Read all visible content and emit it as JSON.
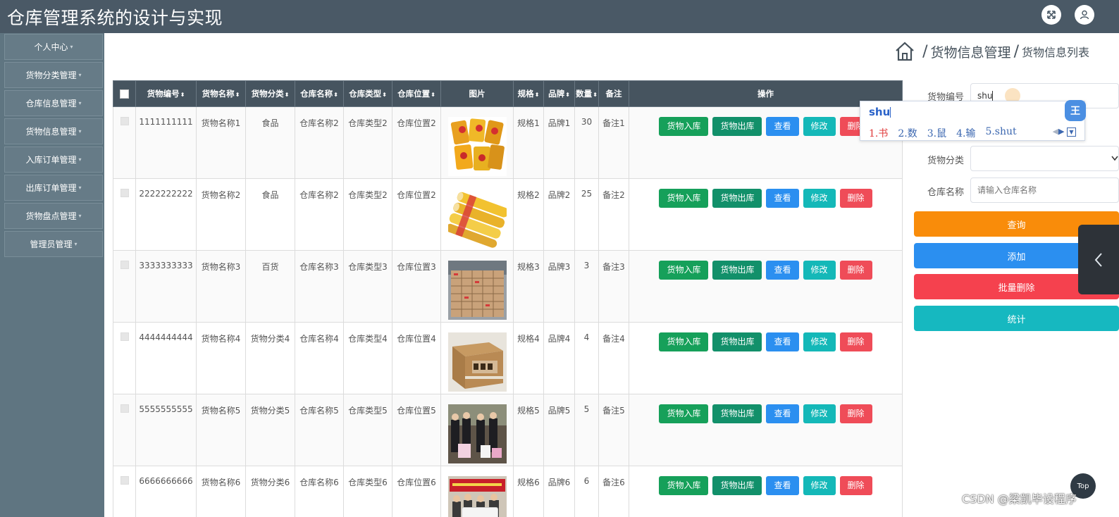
{
  "app": {
    "title": "仓库管理系统的设计与实现"
  },
  "header": {
    "fullscreen_icon": "fullscreen-icon",
    "user_icon": "user-icon"
  },
  "sidebar": {
    "items": [
      {
        "label": "个人中心"
      },
      {
        "label": "货物分类管理"
      },
      {
        "label": "仓库信息管理"
      },
      {
        "label": "货物信息管理"
      },
      {
        "label": "入库订单管理"
      },
      {
        "label": "出库订单管理"
      },
      {
        "label": "货物盘点管理"
      },
      {
        "label": "管理员管理"
      }
    ],
    "caret": "▾"
  },
  "breadcrumb": {
    "separator": "/",
    "main": "货物信息管理",
    "sub": "货物信息列表"
  },
  "table": {
    "columns": [
      "货物编号",
      "货物名称",
      "货物分类",
      "仓库名称",
      "仓库类型",
      "仓库位置",
      "图片",
      "规格",
      "品牌",
      "数量",
      "备注",
      "操作"
    ],
    "sort_glyph": "⬍",
    "rows": [
      {
        "code": "1111111111",
        "name": "货物名称1",
        "category": "食品",
        "warehouse": "仓库名称2",
        "wtype": "仓库类型2",
        "location": "仓库位置2",
        "image": "snack-bags",
        "spec": "规格1",
        "brand": "品牌1",
        "qty": "30",
        "note": "备注1"
      },
      {
        "code": "2222222222",
        "name": "货物名称2",
        "category": "食品",
        "warehouse": "仓库名称2",
        "wtype": "仓库类型2",
        "location": "仓库位置2",
        "image": "chip-cans",
        "spec": "规格2",
        "brand": "品牌2",
        "qty": "25",
        "note": "备注2"
      },
      {
        "code": "3333333333",
        "name": "货物名称3",
        "category": "百货",
        "warehouse": "仓库名称3",
        "wtype": "仓库类型3",
        "location": "仓库位置3",
        "image": "stacked-boxes",
        "spec": "规格3",
        "brand": "品牌3",
        "qty": "3",
        "note": "备注3"
      },
      {
        "code": "4444444444",
        "name": "货物名称4",
        "category": "货物分类4",
        "warehouse": "仓库名称4",
        "wtype": "仓库类型4",
        "location": "仓库位置4",
        "image": "cardboard-box",
        "spec": "规格4",
        "brand": "品牌4",
        "qty": "4",
        "note": "备注4"
      },
      {
        "code": "5555555555",
        "name": "货物名称5",
        "category": "货物分类5",
        "warehouse": "仓库名称5",
        "wtype": "仓库类型5",
        "location": "仓库位置5",
        "image": "people-with-goods",
        "spec": "规格5",
        "brand": "品牌5",
        "qty": "5",
        "note": "备注5"
      },
      {
        "code": "6666666666",
        "name": "货物名称6",
        "category": "货物分类6",
        "warehouse": "仓库名称6",
        "wtype": "仓库类型6",
        "location": "仓库位置6",
        "image": "group-with-banner",
        "spec": "规格6",
        "brand": "品牌6",
        "qty": "6",
        "note": "备注6"
      }
    ],
    "actions": {
      "stock_in": "货物入库",
      "stock_out": "货物出库",
      "view": "查看",
      "edit": "修改",
      "delete": "删除"
    }
  },
  "search": {
    "code_label": "货物编号",
    "code_value": "shu",
    "category_label": "货物分类",
    "category_value": "",
    "warehouse_label": "仓库名称",
    "warehouse_placeholder": "请输入仓库名称",
    "query_button": "查询",
    "add_button": "添加",
    "batch_delete_button": "批量删除",
    "stats_button": "统计"
  },
  "ime": {
    "composition": "shu",
    "candidates": [
      "1.书",
      "2.数",
      "3.鼠",
      "4.输",
      "5.shut"
    ],
    "logo": "王"
  },
  "misc": {
    "top_button": "Top",
    "watermark": "CSDN @梁凯毕设程序"
  },
  "colors": {
    "header_bg": "#4a5966",
    "sidebar_bg": "#5f7581",
    "query": "#f98c0a",
    "add": "#2b8ff0",
    "batch_delete": "#f5414e",
    "stats": "#16b8c0",
    "stock_in": "#16a05a",
    "stock_out": "#12906a",
    "view": "#2b8ff0",
    "edit": "#14b8b8",
    "delete": "#ef4c58"
  }
}
